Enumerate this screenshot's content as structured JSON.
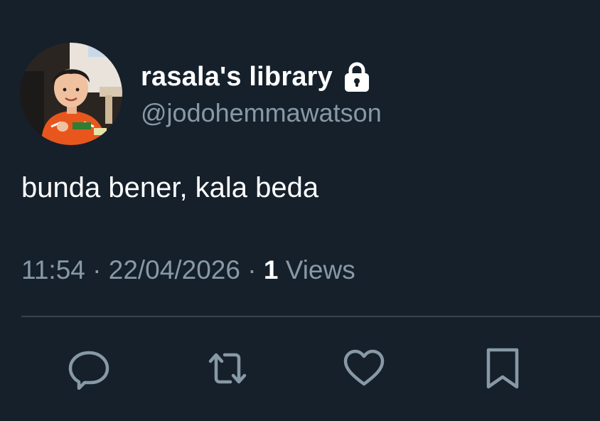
{
  "user": {
    "display_name": "rasala's library",
    "handle": "@jodohemmawatson",
    "protected_icon": "lock-icon",
    "avatar": "profile-photo"
  },
  "tweet": {
    "text": "bunda bener, kala beda"
  },
  "meta": {
    "time": "11:54",
    "separator": "·",
    "date": "22/04/2026",
    "views_count": "1",
    "views_label": "Views"
  },
  "actions": [
    {
      "name": "reply",
      "icon": "comment-icon"
    },
    {
      "name": "retweet",
      "icon": "retweet-icon"
    },
    {
      "name": "like",
      "icon": "heart-icon"
    },
    {
      "name": "bookmark",
      "icon": "bookmark-icon"
    }
  ],
  "colors": {
    "background": "#15202b",
    "primary_text": "#ffffff",
    "secondary_text": "#8899a6",
    "divider": "#38444d"
  }
}
